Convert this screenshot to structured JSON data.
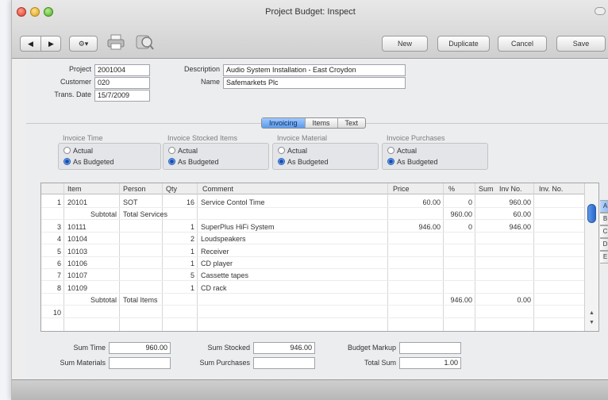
{
  "window": {
    "title": "Project Budget: Inspect"
  },
  "toolbar": {
    "prev_arrow": "◀",
    "next_arrow": "▶",
    "gear_label": "⚙▾",
    "print_icon": "printer-icon",
    "preview_icon": "print-preview-icon",
    "new_label": "New",
    "duplicate_label": "Duplicate",
    "cancel_label": "Cancel",
    "save_label": "Save"
  },
  "header": {
    "project_label": "Project",
    "project_value": "2001004",
    "customer_label": "Customer",
    "customer_value": "020",
    "trans_date_label": "Trans. Date",
    "trans_date_value": "15/7/2009",
    "description_label": "Description",
    "description_value": "Audio System Installation - East Croydon",
    "name_label": "Name",
    "name_value": "Safemarkets Plc"
  },
  "tabs": [
    {
      "label": "Invoicing",
      "active": true
    },
    {
      "label": "Items",
      "active": false
    },
    {
      "label": "Text",
      "active": false
    }
  ],
  "groups": [
    {
      "title": "Invoice Time",
      "options": [
        "Actual",
        "As Budgeted"
      ],
      "selected": 1
    },
    {
      "title": "Invoice Stocked Items",
      "options": [
        "Actual",
        "As Budgeted"
      ],
      "selected": 1
    },
    {
      "title": "Invoice Material",
      "options": [
        "Actual",
        "As Budgeted"
      ],
      "selected": 1
    },
    {
      "title": "Invoice Purchases",
      "options": [
        "Actual",
        "As Budgeted"
      ],
      "selected": 1
    }
  ],
  "grid": {
    "columns": [
      "Item",
      "Person",
      "Qty",
      "Comment",
      "Price",
      "%",
      "Sum",
      "Inv No.",
      "Inv. No."
    ],
    "rows": [
      {
        "no": "1",
        "item": "20101",
        "person": "SOT",
        "qty": "16",
        "comment": "Service Contol Time",
        "price": "60.00",
        "pct": "0",
        "sum": "960.00",
        "invno": ""
      },
      {
        "no": "",
        "item": "Subtotal",
        "person": "Total Services",
        "qty": "",
        "comment": "",
        "price": "",
        "pct": "960.00",
        "sum": "60.00",
        "invno": ""
      },
      {
        "no": "3",
        "item": "10111",
        "person": "",
        "qty": "1",
        "comment": "SuperPlus HiFi System",
        "price": "946.00",
        "pct": "0",
        "sum": "946.00",
        "invno": ""
      },
      {
        "no": "4",
        "item": "10104",
        "person": "",
        "qty": "2",
        "comment": "Loudspeakers",
        "price": "",
        "pct": "",
        "sum": "",
        "invno": ""
      },
      {
        "no": "5",
        "item": "10103",
        "person": "",
        "qty": "1",
        "comment": "Receiver",
        "price": "",
        "pct": "",
        "sum": "",
        "invno": ""
      },
      {
        "no": "6",
        "item": "10106",
        "person": "",
        "qty": "1",
        "comment": "CD player",
        "price": "",
        "pct": "",
        "sum": "",
        "invno": ""
      },
      {
        "no": "7",
        "item": "10107",
        "person": "",
        "qty": "5",
        "comment": "Cassette tapes",
        "price": "",
        "pct": "",
        "sum": "",
        "invno": ""
      },
      {
        "no": "8",
        "item": "10109",
        "person": "",
        "qty": "1",
        "comment": "CD rack",
        "price": "",
        "pct": "",
        "sum": "",
        "invno": ""
      },
      {
        "no": "",
        "item": "Subtotal",
        "person": "Total Items",
        "qty": "",
        "comment": "",
        "price": "",
        "pct": "946.00",
        "sum": "0.00",
        "invno": ""
      },
      {
        "no": "10",
        "item": "",
        "person": "",
        "qty": "",
        "comment": "",
        "price": "",
        "pct": "",
        "sum": "",
        "invno": ""
      }
    ],
    "letter_tabs": [
      "A",
      "B",
      "C",
      "D",
      "E"
    ]
  },
  "footer": {
    "sum_time_label": "Sum Time",
    "sum_time_value": "960.00",
    "sum_stocked_label": "Sum Stocked",
    "sum_stocked_value": "946.00",
    "budget_markup_label": "Budget Markup",
    "budget_markup_value": "",
    "sum_materials_label": "Sum Materials",
    "sum_materials_value": "",
    "sum_purchases_label": "Sum Purchases",
    "sum_purchases_value": "",
    "total_sum_label": "Total Sum",
    "total_sum_value": "1.00"
  }
}
